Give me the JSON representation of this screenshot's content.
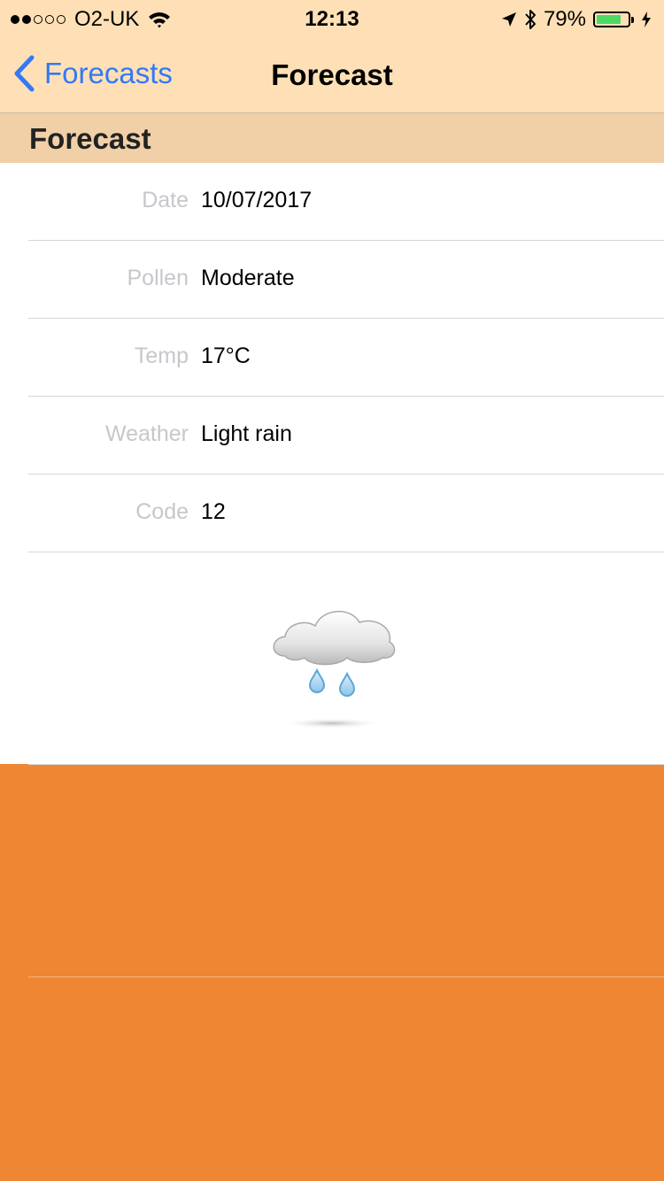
{
  "status_bar": {
    "signal_filled": 2,
    "signal_total": 5,
    "carrier": "O2-UK",
    "time": "12:13",
    "battery_percent": "79%",
    "battery_level": 0.79,
    "icons": [
      "wifi-icon",
      "location-arrow-icon",
      "bluetooth-icon",
      "battery-icon",
      "charging-bolt-icon"
    ]
  },
  "nav": {
    "back_label": "Forecasts",
    "title": "Forecast"
  },
  "section": {
    "header": "Forecast"
  },
  "details": [
    {
      "label": "Date",
      "value": "10/07/2017"
    },
    {
      "label": "Pollen",
      "value": "Moderate"
    },
    {
      "label": "Temp",
      "value": "17°C"
    },
    {
      "label": "Weather",
      "value": "Light rain"
    },
    {
      "label": "Code",
      "value": "12"
    }
  ],
  "weather_icon": "light-rain-cloud-icon",
  "colors": {
    "nav_background": "#FFE0B6",
    "section_header_background": "#F1D0A8",
    "accent_blue": "#3478F6",
    "page_background_orange": "#EE8633",
    "battery_green": "#4CD964"
  }
}
